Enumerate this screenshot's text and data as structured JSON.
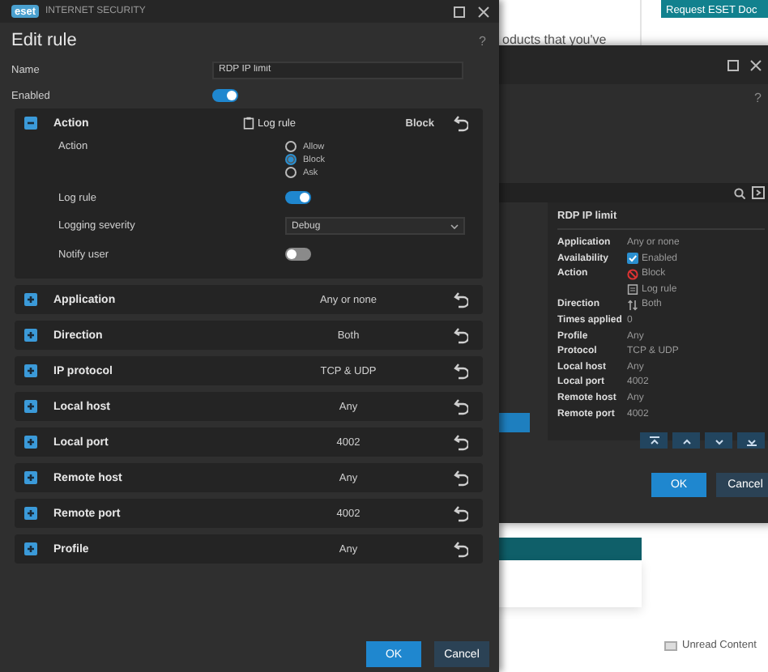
{
  "background_page": {
    "text_fragment": "oducts that you've",
    "request_button": "Request ESET Doc",
    "unread": "Unread Content"
  },
  "back_window": {
    "help": "?",
    "detail_title": "RDP IP limit",
    "details": [
      {
        "label": "Application",
        "value": "Any or none",
        "kind": "text"
      },
      {
        "label": "Availability",
        "value": "Enabled",
        "kind": "checkbox",
        "checked": true
      },
      {
        "label": "Action",
        "value": "Block",
        "kind": "block"
      },
      {
        "value": "Log rule",
        "kind": "log"
      },
      {
        "label": "Direction",
        "value": "Both",
        "kind": "direction"
      },
      {
        "label": "Times applied",
        "value": "0",
        "kind": "text"
      },
      {
        "label": "Profile",
        "value": "Any",
        "kind": "text"
      },
      {
        "label": "Protocol",
        "value": "TCP & UDP",
        "kind": "text"
      },
      {
        "label": "Local host",
        "value": "Any",
        "kind": "text"
      },
      {
        "label": "Local port",
        "value": "4002",
        "kind": "text"
      },
      {
        "label": "Remote host",
        "value": "Any",
        "kind": "text"
      },
      {
        "label": "Remote port",
        "value": "4002",
        "kind": "text"
      }
    ],
    "buttons": [
      {
        "label": "OK",
        "kind": "primary"
      },
      {
        "label": "Cancel",
        "kind": "secondary"
      }
    ]
  },
  "dialog": {
    "brand": "INTERNET SECURITY",
    "logo": "eset",
    "title": "Edit rule",
    "help": "?",
    "name": {
      "label": "Name",
      "value": "RDP IP limit"
    },
    "enabled": {
      "label": "Enabled",
      "on": true
    },
    "sections": [
      {
        "title": "Action",
        "expanded": true,
        "log_summary": "Log rule",
        "summary": "Block",
        "action": {
          "label": "Action",
          "options": [
            {
              "label": "Allow",
              "selected": false
            },
            {
              "label": "Block",
              "selected": true
            },
            {
              "label": "Ask",
              "selected": false
            }
          ]
        },
        "log_rule": {
          "label": "Log rule",
          "on": true
        },
        "severity": {
          "label": "Logging severity",
          "value": "Debug"
        },
        "notify": {
          "label": "Notify user",
          "on": false
        }
      },
      {
        "title": "Application",
        "expanded": false,
        "summary": "Any or none"
      },
      {
        "title": "Direction",
        "expanded": false,
        "summary": "Both"
      },
      {
        "title": "IP protocol",
        "expanded": false,
        "summary": "TCP & UDP"
      },
      {
        "title": "Local host",
        "expanded": false,
        "summary": "Any"
      },
      {
        "title": "Local port",
        "expanded": false,
        "summary": "4002"
      },
      {
        "title": "Remote host",
        "expanded": false,
        "summary": "Any"
      },
      {
        "title": "Remote port",
        "expanded": false,
        "summary": "4002"
      },
      {
        "title": "Profile",
        "expanded": false,
        "summary": "Any"
      }
    ],
    "buttons": [
      {
        "label": "OK",
        "kind": "primary"
      },
      {
        "label": "Cancel",
        "kind": "secondary"
      }
    ]
  }
}
